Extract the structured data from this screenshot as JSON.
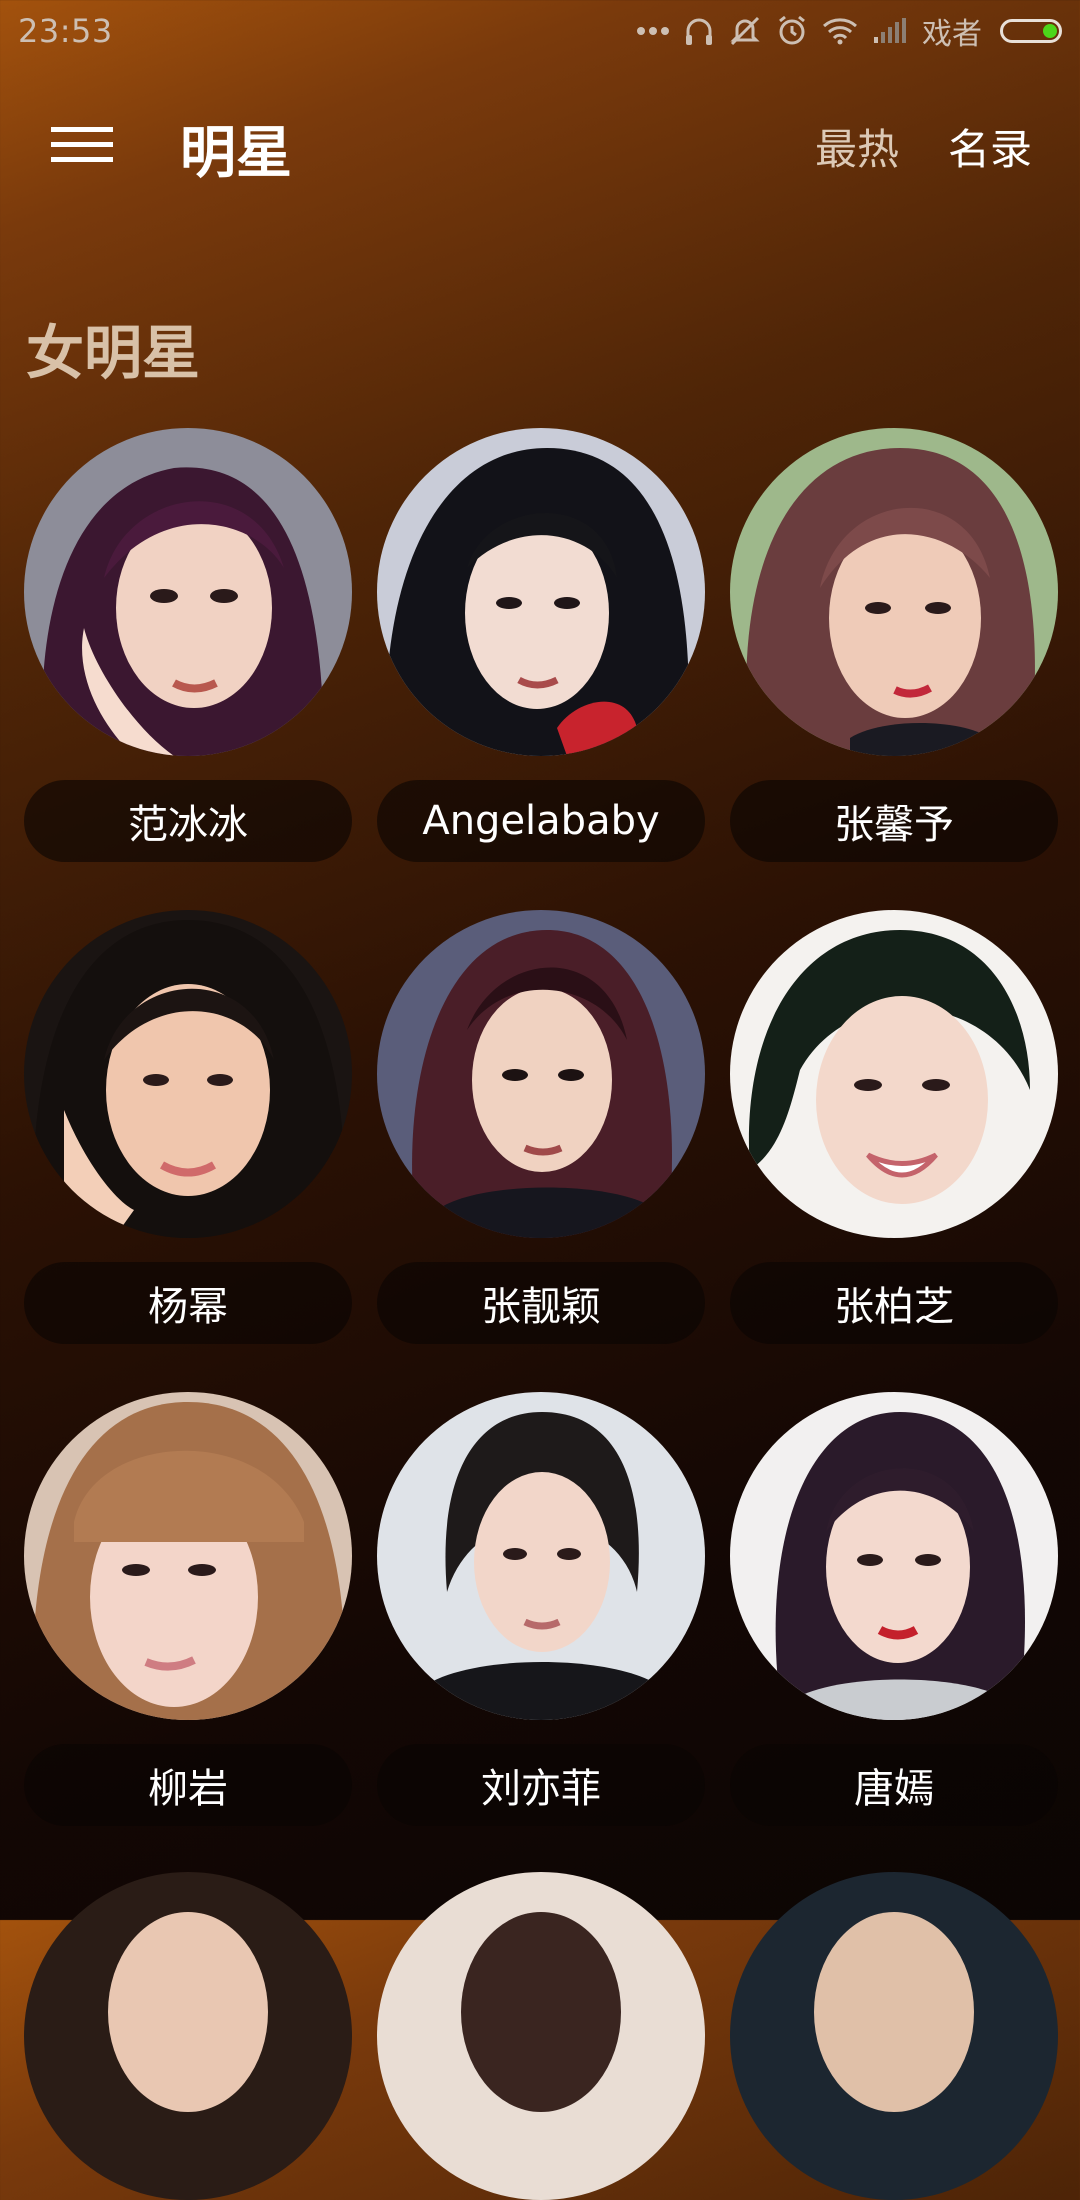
{
  "status_bar": {
    "time": "23:53",
    "carrier": "戏者",
    "battery_level": 0.25,
    "icons": [
      "more-dots-icon",
      "headset-icon",
      "mute-icon",
      "alarm-icon",
      "wifi-icon",
      "signal-icon",
      "battery-icon"
    ]
  },
  "toolbar": {
    "menu_icon": "hamburger-menu-icon",
    "title": "明星",
    "actions": [
      {
        "label": "最热"
      },
      {
        "label": "名录"
      }
    ]
  },
  "section": {
    "title": "女明星",
    "items": [
      {
        "name": "范冰冰",
        "photo": "portrait-photo"
      },
      {
        "name": "Angelababy",
        "photo": "portrait-photo"
      },
      {
        "name": "张馨予",
        "photo": "portrait-photo"
      },
      {
        "name": "杨幂",
        "photo": "portrait-photo"
      },
      {
        "name": "张靓颖",
        "photo": "portrait-photo"
      },
      {
        "name": "张柏芝",
        "photo": "portrait-photo"
      },
      {
        "name": "柳岩",
        "photo": "portrait-photo"
      },
      {
        "name": "刘亦菲",
        "photo": "portrait-photo"
      },
      {
        "name": "唐嫣",
        "photo": "portrait-photo"
      }
    ]
  },
  "colors": {
    "accent_text": "#d8c1a8",
    "battery_green": "#4cd61a",
    "pill_background": "#0a0503"
  }
}
